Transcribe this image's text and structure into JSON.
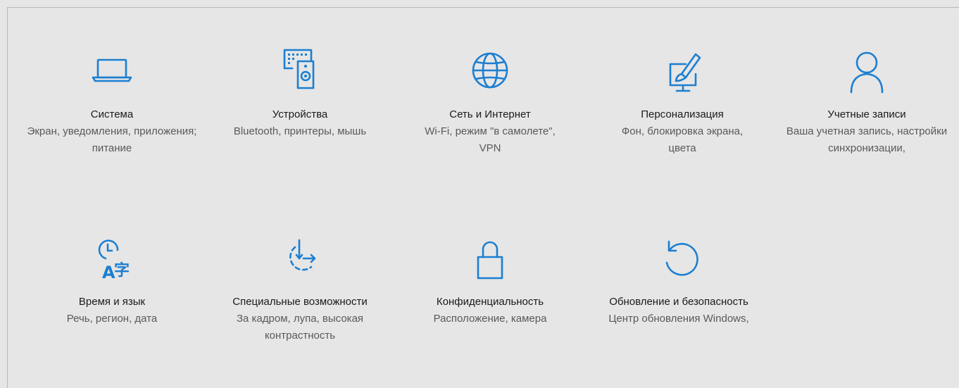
{
  "accent_color": "#1c7fd1",
  "tiles": [
    {
      "title": "Система",
      "desc": "Экран, уведомления, приложения; питание",
      "icon": "laptop-icon"
    },
    {
      "title": "Устройства",
      "desc": "Bluetooth, принтеры, мышь",
      "icon": "devices-icon"
    },
    {
      "title": "Сеть и Интернет",
      "desc": "Wi-Fi, режим \"в самолете\", VPN",
      "icon": "globe-icon"
    },
    {
      "title": "Персонализация",
      "desc": "Фон, блокировка экрана, цвета",
      "icon": "paint-monitor-icon"
    },
    {
      "title": "Учетные записи",
      "desc": "Ваша учетная запись, настройки синхронизации,",
      "icon": "person-icon"
    },
    {
      "title": "Время и язык",
      "desc": "Речь, регион, дата",
      "icon": "time-language-icon"
    },
    {
      "title": "Специальные возможности",
      "desc": "За кадром, лупа, высокая контрастность",
      "icon": "ease-of-access-icon"
    },
    {
      "title": "Конфиденциальность",
      "desc": "Расположение, камера",
      "icon": "lock-icon"
    },
    {
      "title": "Обновление и безопасность",
      "desc": "Центр обновления Windows,",
      "icon": "update-icon"
    }
  ]
}
